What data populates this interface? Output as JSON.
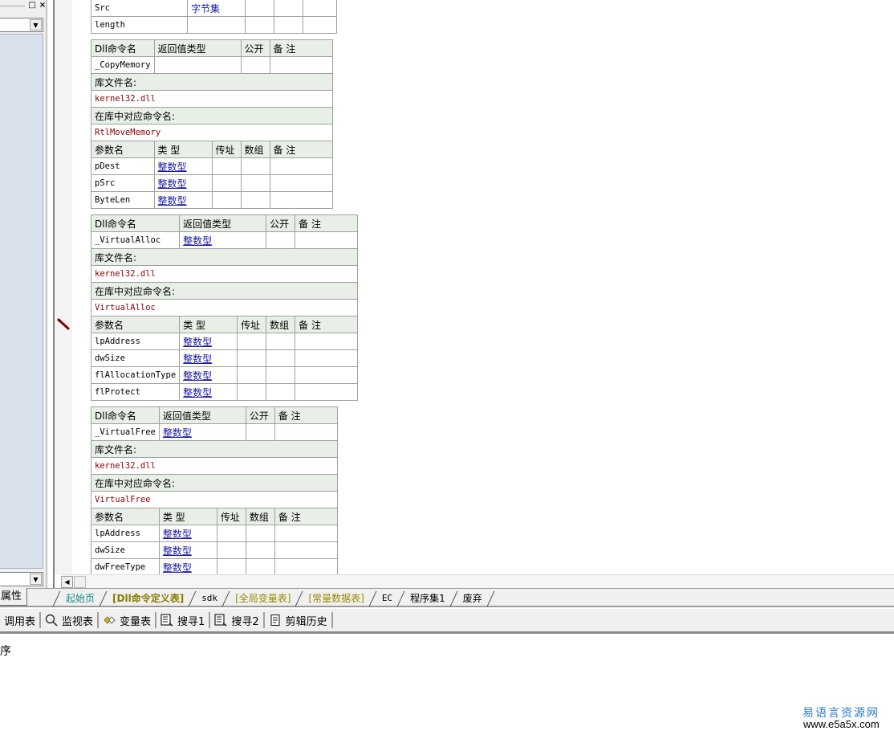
{
  "left_panel": {
    "window_buttons": {
      "maximize": "□",
      "close": "×"
    },
    "combo_arrow": "▼",
    "scroll_arrow": "▼",
    "bottom_tab": "属性"
  },
  "top_partial_table": {
    "rows": [
      {
        "name": "Src",
        "type": "字节集",
        "byref": "",
        "array": "",
        "note": ""
      },
      {
        "name": "length",
        "type": "",
        "byref": "",
        "array": "",
        "note": ""
      }
    ]
  },
  "dll_headers": {
    "cmd_name": "Dll命令名",
    "return_type": "返回值类型",
    "public": "公开",
    "note": "备 注",
    "lib_file": "库文件名:",
    "lib_cmd": "在库中对应命令名:",
    "param_name": "参数名",
    "type": "类 型",
    "byref": "传址",
    "array": "数组",
    "param_note": "备 注"
  },
  "dll_commands": [
    {
      "name": "_CopyMemory",
      "return_type": "",
      "lib_file": "kernel32.dll",
      "lib_cmd": "RtlMoveMemory",
      "params": [
        {
          "name": "pDest",
          "type": "整数型"
        },
        {
          "name": "pSrc",
          "type": "整数型"
        },
        {
          "name": "ByteLen",
          "type": "整数型"
        }
      ]
    },
    {
      "name": "_VirtualAlloc",
      "return_type": "整数型",
      "lib_file": "kernel32.dll",
      "lib_cmd": "VirtualAlloc",
      "params": [
        {
          "name": "lpAddress",
          "type": "整数型"
        },
        {
          "name": "dwSize",
          "type": "整数型"
        },
        {
          "name": "flAllocationType",
          "type": "整数型"
        },
        {
          "name": "flProtect",
          "type": "整数型"
        }
      ]
    },
    {
      "name": "_VirtualFree",
      "return_type": "整数型",
      "lib_file": "kernel32.dll",
      "lib_cmd": "VirtualFree",
      "params": [
        {
          "name": "lpAddress",
          "type": "整数型"
        },
        {
          "name": "dwSize",
          "type": "整数型"
        },
        {
          "name": "dwFreeType",
          "type": "整数型"
        }
      ]
    }
  ],
  "scroll": {
    "left_arrow": "◀"
  },
  "doc_tabs": [
    {
      "label": "起始页",
      "style": "first"
    },
    {
      "label": "[Dll命令定义表]",
      "style": "active"
    },
    {
      "label": "sdk",
      "style": "mono-tab"
    },
    {
      "label": "[全局变量表]",
      "style": "olive"
    },
    {
      "label": "[常量数据表]",
      "style": "olive"
    },
    {
      "label": "EC",
      "style": "mono-tab"
    },
    {
      "label": "程序集1",
      "style": ""
    },
    {
      "label": "废弃",
      "style": ""
    }
  ],
  "toolbar": {
    "items": [
      {
        "label": "调用表",
        "icon": ""
      },
      {
        "label": "监视表",
        "icon": "magnifier-icon"
      },
      {
        "label": "变量表",
        "icon": "variables-icon"
      },
      {
        "label": "搜寻1",
        "icon": "search-list-icon"
      },
      {
        "label": "搜寻2",
        "icon": "search-list-icon"
      },
      {
        "label": "剪辑历史",
        "icon": "clipboard-history-icon"
      }
    ]
  },
  "output": {
    "text": "序"
  },
  "watermark": {
    "title": "易语言资源网",
    "url": "www.e5a5x.com"
  }
}
